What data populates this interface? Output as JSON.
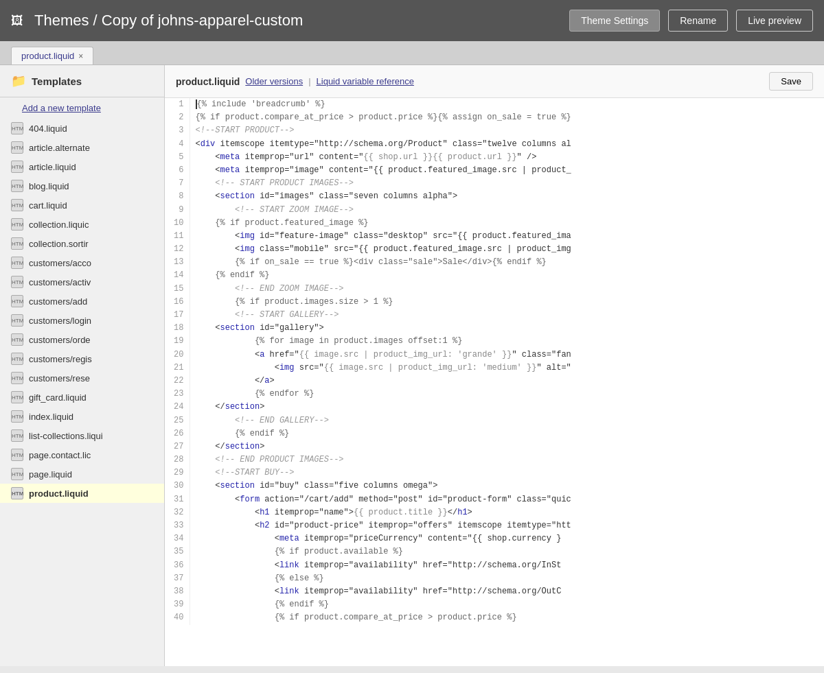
{
  "header": {
    "icon": "🖼",
    "title": "Themes / Copy of johns-apparel-custom",
    "theme_settings_label": "Theme Settings",
    "rename_label": "Rename",
    "live_preview_label": "Live preview"
  },
  "tab": {
    "label": "product.liquid",
    "close": "×"
  },
  "sidebar": {
    "title": "Templates",
    "add_link": "Add a new template",
    "items": [
      {
        "name": "404.liquid",
        "active": false
      },
      {
        "name": "article.alternate",
        "active": false
      },
      {
        "name": "article.liquid",
        "active": false
      },
      {
        "name": "blog.liquid",
        "active": false
      },
      {
        "name": "cart.liquid",
        "active": false
      },
      {
        "name": "collection.liquic",
        "active": false
      },
      {
        "name": "collection.sortir",
        "active": false
      },
      {
        "name": "customers/acco",
        "active": false
      },
      {
        "name": "customers/activ",
        "active": false
      },
      {
        "name": "customers/add",
        "active": false
      },
      {
        "name": "customers/login",
        "active": false
      },
      {
        "name": "customers/orde",
        "active": false
      },
      {
        "name": "customers/regis",
        "active": false
      },
      {
        "name": "customers/rese",
        "active": false
      },
      {
        "name": "gift_card.liquid",
        "active": false
      },
      {
        "name": "index.liquid",
        "active": false
      },
      {
        "name": "list-collections.liqui",
        "active": false
      },
      {
        "name": "page.contact.lic",
        "active": false
      },
      {
        "name": "page.liquid",
        "active": false
      },
      {
        "name": "product.liquid",
        "active": true
      }
    ]
  },
  "editor": {
    "filename": "product.liquid",
    "older_versions": "Older versions",
    "separator": "|",
    "liquid_var_ref": "Liquid variable reference",
    "save_label": "Save"
  },
  "code_lines": [
    {
      "num": 1,
      "text": "{% include 'breadcrumb' %}"
    },
    {
      "num": 2,
      "text": "{% if product.compare_at_price > product.price %}{% assign on_sale = true %}"
    },
    {
      "num": 3,
      "text": "<!--START PRODUCT-->"
    },
    {
      "num": 4,
      "text": "<div itemscope itemtype=\"http://schema.org/Product\" class=\"twelve columns al"
    },
    {
      "num": 5,
      "text": "    <meta itemprop=\"url\" content=\"{{ shop.url }}{{ product.url }}\" />"
    },
    {
      "num": 6,
      "text": "    <meta itemprop=\"image\" content=\"{{ product.featured_image.src | product_"
    },
    {
      "num": 7,
      "text": "    <!-- START PRODUCT IMAGES-->"
    },
    {
      "num": 8,
      "text": "    <section id=\"images\" class=\"seven columns alpha\">"
    },
    {
      "num": 9,
      "text": "        <!-- START ZOOM IMAGE-->"
    },
    {
      "num": 10,
      "text": "    {% if product.featured_image %}"
    },
    {
      "num": 11,
      "text": "        <img id=\"feature-image\" class=\"desktop\" src=\"{{ product.featured_ima"
    },
    {
      "num": 12,
      "text": "        <img class=\"mobile\" src=\"{{ product.featured_image.src | product_img"
    },
    {
      "num": 13,
      "text": "        {% if on_sale == true %}<div class=\"sale\">Sale</div>{% endif %}"
    },
    {
      "num": 14,
      "text": "    {% endif %}"
    },
    {
      "num": 15,
      "text": "        <!-- END ZOOM IMAGE-->"
    },
    {
      "num": 16,
      "text": "        {% if product.images.size > 1 %}"
    },
    {
      "num": 17,
      "text": "        <!-- START GALLERY-->"
    },
    {
      "num": 18,
      "text": "    <section id=\"gallery\">"
    },
    {
      "num": 19,
      "text": "            {% for image in product.images offset:1 %}"
    },
    {
      "num": 20,
      "text": "            <a href=\"{{ image.src | product_img_url: 'grande' }}\" class=\"fan"
    },
    {
      "num": 21,
      "text": "                <img src=\"{{ image.src | product_img_url: 'medium' }}\" alt=\""
    },
    {
      "num": 22,
      "text": "            </a>"
    },
    {
      "num": 23,
      "text": "            {% endfor %}"
    },
    {
      "num": 24,
      "text": "    </section>"
    },
    {
      "num": 25,
      "text": "        <!-- END GALLERY-->"
    },
    {
      "num": 26,
      "text": "        {% endif %}"
    },
    {
      "num": 27,
      "text": "    </section>"
    },
    {
      "num": 28,
      "text": "    <!-- END PRODUCT IMAGES-->"
    },
    {
      "num": 29,
      "text": "    <!--START BUY-->"
    },
    {
      "num": 30,
      "text": "    <section id=\"buy\" class=\"five columns omega\">"
    },
    {
      "num": 31,
      "text": "        <form action=\"/cart/add\" method=\"post\" id=\"product-form\" class=\"quic"
    },
    {
      "num": 32,
      "text": "            <h1 itemprop=\"name\">{{ product.title }}</h1>"
    },
    {
      "num": 33,
      "text": "            <h2 id=\"product-price\" itemprop=\"offers\" itemscope itemtype=\"htt"
    },
    {
      "num": 34,
      "text": "                <meta itemprop=\"priceCurrency\" content=\"{{ shop.currency }"
    },
    {
      "num": 35,
      "text": "                {% if product.available %}"
    },
    {
      "num": 36,
      "text": "                <link itemprop=\"availability\" href=\"http://schema.org/InSt"
    },
    {
      "num": 37,
      "text": "                {% else %}"
    },
    {
      "num": 38,
      "text": "                <link itemprop=\"availability\" href=\"http://schema.org/OutC"
    },
    {
      "num": 39,
      "text": "                {% endif %}"
    },
    {
      "num": 40,
      "text": "                {% if product.compare_at_price > product.price %}"
    }
  ]
}
